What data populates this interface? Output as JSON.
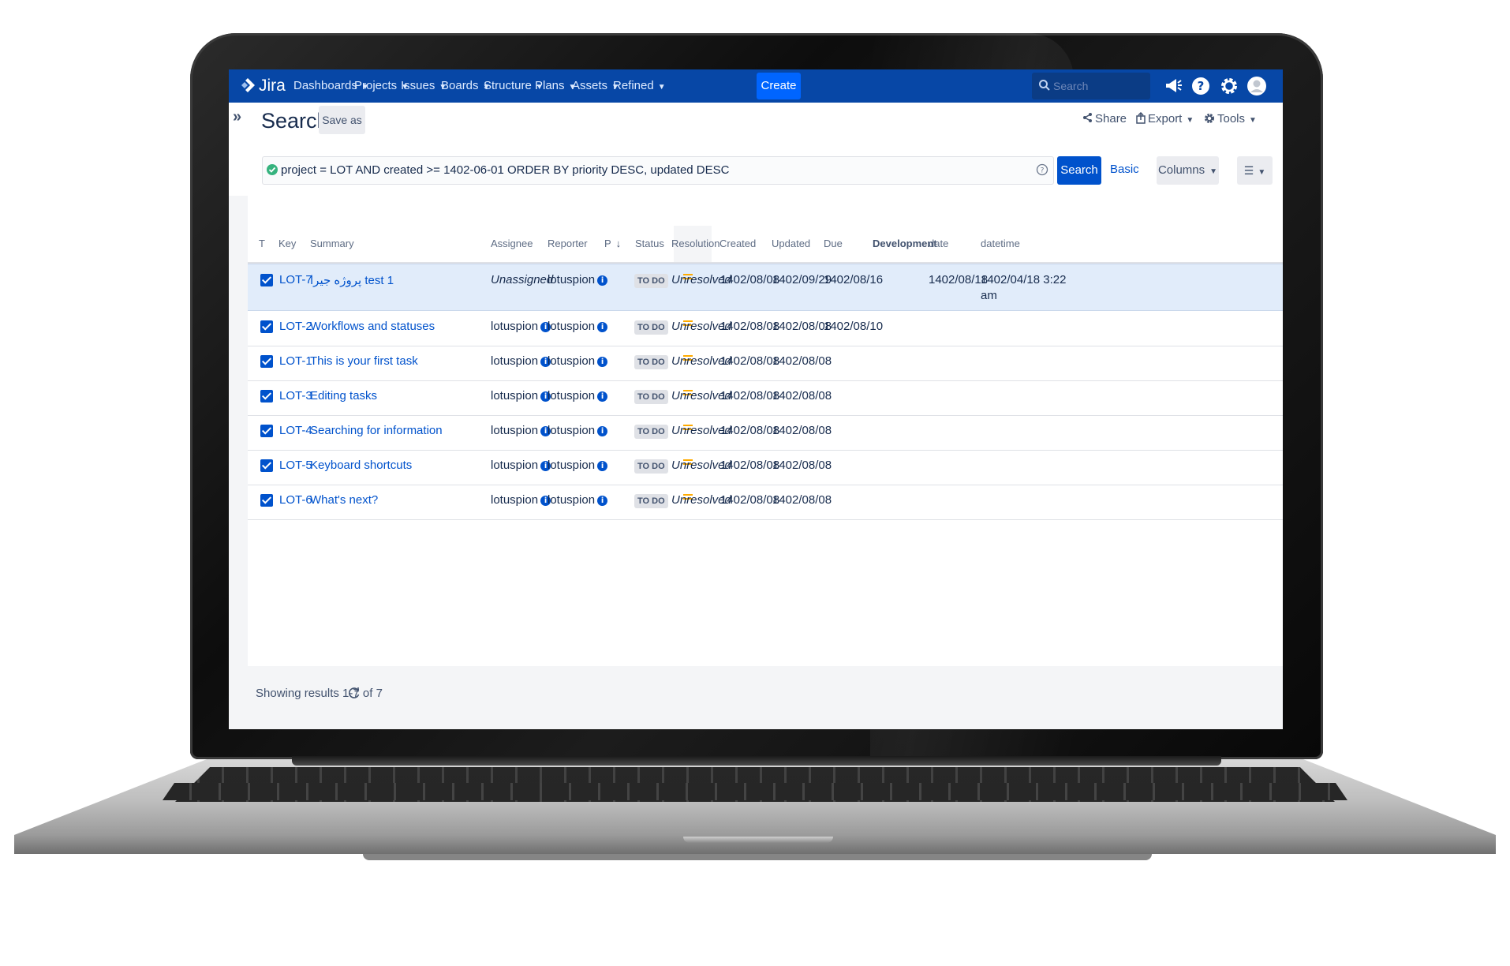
{
  "nav": {
    "logo": "Jira",
    "items": [
      {
        "label": "Dashboards"
      },
      {
        "label": "Projects"
      },
      {
        "label": "Issues"
      },
      {
        "label": "Boards"
      },
      {
        "label": "Structure"
      },
      {
        "label": "Plans"
      },
      {
        "label": "Assets"
      },
      {
        "label": "Refined"
      }
    ],
    "create_label": "Create",
    "search_placeholder": "Search",
    "icons": [
      "megaphone-icon",
      "help-icon",
      "settings-icon",
      "avatar"
    ]
  },
  "page": {
    "title": "Search",
    "save_as": "Save as",
    "share": "Share",
    "export": "Export",
    "tools": "Tools"
  },
  "jql": {
    "query": "project = LOT AND created >= 1402-06-01 ORDER BY priority DESC, updated DESC",
    "search_label": "Search",
    "basic_label": "Basic",
    "columns_label": "Columns"
  },
  "table": {
    "headers": {
      "t": "T",
      "key": "Key",
      "summary": "Summary",
      "assignee": "Assignee",
      "reporter": "Reporter",
      "priority": "P",
      "status": "Status",
      "resolution": "Resolution",
      "created": "Created",
      "updated": "Updated",
      "due": "Due",
      "development": "Development",
      "date": "date",
      "datetime": "datetime"
    },
    "rows": [
      {
        "key": "LOT-7",
        "summary": "پروژه جیرا test 1",
        "assignee": "Unassigned",
        "reporter": "lotuspion",
        "status": "TO DO",
        "resolution": "Unresolved",
        "created": "1402/08/08",
        "updated": "1402/09/29",
        "due": "1402/08/16",
        "date": "1402/08/18",
        "datetime_line1": "1402/04/18 3:22",
        "datetime_line2": "am"
      },
      {
        "key": "LOT-2",
        "summary": "Workflows and statuses",
        "assignee": "lotuspion",
        "reporter": "lotuspion",
        "status": "TO DO",
        "resolution": "Unresolved",
        "created": "1402/08/08",
        "updated": "1402/08/08",
        "due": "1402/08/10"
      },
      {
        "key": "LOT-1",
        "summary": "This is your first task",
        "assignee": "lotuspion",
        "reporter": "lotuspion",
        "status": "TO DO",
        "resolution": "Unresolved",
        "created": "1402/08/08",
        "updated": "1402/08/08"
      },
      {
        "key": "LOT-3",
        "summary": "Editing tasks",
        "assignee": "lotuspion",
        "reporter": "lotuspion",
        "status": "TO DO",
        "resolution": "Unresolved",
        "created": "1402/08/08",
        "updated": "1402/08/08"
      },
      {
        "key": "LOT-4",
        "summary": "Searching for information",
        "assignee": "lotuspion",
        "reporter": "lotuspion",
        "status": "TO DO",
        "resolution": "Unresolved",
        "created": "1402/08/08",
        "updated": "1402/08/08"
      },
      {
        "key": "LOT-5",
        "summary": "Keyboard shortcuts",
        "assignee": "lotuspion",
        "reporter": "lotuspion",
        "status": "TO DO",
        "resolution": "Unresolved",
        "created": "1402/08/08",
        "updated": "1402/08/08"
      },
      {
        "key": "LOT-6",
        "summary": "What's next?",
        "assignee": "lotuspion",
        "reporter": "lotuspion",
        "status": "TO DO",
        "resolution": "Unresolved",
        "created": "1402/08/08",
        "updated": "1402/08/08"
      }
    ]
  },
  "footer": {
    "results": "Showing results 1-7 of 7"
  },
  "colors": {
    "nav_bg": "#0747a6",
    "accent": "#0052cc",
    "priority_medium": "#ffab00",
    "selected_row": "#e1ecfa"
  }
}
